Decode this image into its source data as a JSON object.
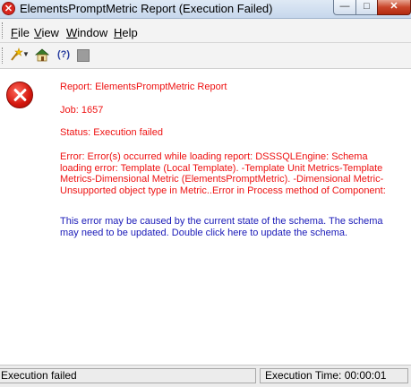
{
  "window": {
    "title": "ElementsPromptMetric Report (Execution Failed)",
    "controls": {
      "minimize": "—",
      "maximize": "□",
      "close": "✕"
    }
  },
  "menu": {
    "file": {
      "hotkey": "F",
      "rest": "ile"
    },
    "view": {
      "hotkey": "V",
      "rest": "iew"
    },
    "window": {
      "hotkey": "W",
      "rest": "indow"
    },
    "help": {
      "hotkey": "H",
      "rest": "elp"
    }
  },
  "toolbar": {
    "icons": [
      "wand-icon",
      "dropdown-icon",
      "home-icon",
      "help-icon",
      "stop-icon"
    ],
    "help_glyph": "(?)"
  },
  "content": {
    "report_line": "Report: ElementsPromptMetric Report",
    "job_line": "Job: 1657",
    "status_line": "Status: Execution failed",
    "error_text": "Error: Error(s) occurred while loading report: DSSSQLEngine: Schema loading error: Template (Local Template). -Template Unit Metrics-Template Metrics-Dimensional Metric (ElementsPromptMetric). -Dimensional Metric-Unsupported object type in Metric..Error in Process method of Component:",
    "hint_text": "This error may be caused by the current state of the schema. The schema may need to be updated. Double click here to update the schema.",
    "error_color": "#ee1111",
    "hint_color": "#1a1ab8"
  },
  "statusbar": {
    "left": "Execution failed",
    "right": "Execution Time: 00:00:01"
  }
}
